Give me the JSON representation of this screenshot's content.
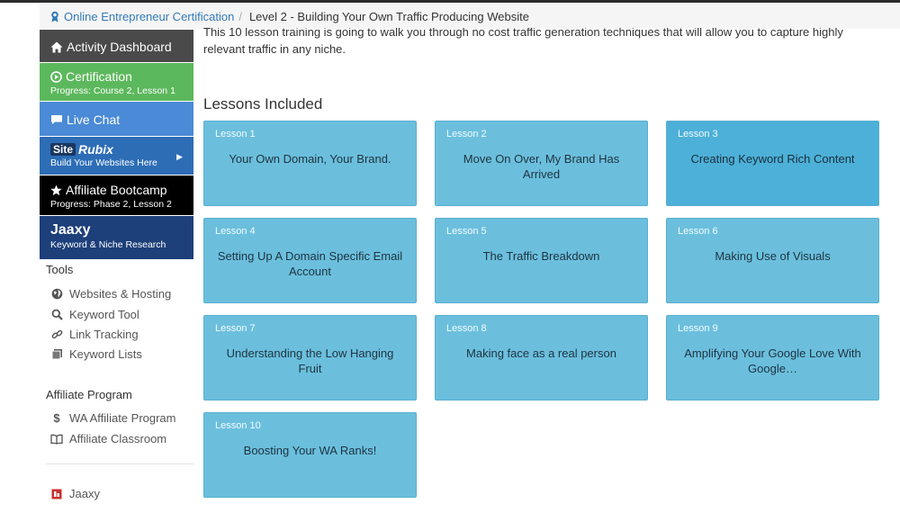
{
  "breadcrumb": {
    "link": "Online Entrepreneur Certification",
    "separator": "/",
    "current": "Level 2 - Building Your Own Traffic Producing Website"
  },
  "sidebar": {
    "dashboard": "Activity Dashboard",
    "certification": {
      "label": "Certification",
      "progress": "Progress: Course 2, Lesson 1"
    },
    "live_chat": "Live Chat",
    "siterubix": {
      "logo_site": "Site",
      "logo_rubix": "Rubix",
      "tagline": "Build Your Websites Here"
    },
    "bootcamp": {
      "label": "Affiliate Bootcamp",
      "progress": "Progress: Phase 2, Lesson 2"
    },
    "jaaxy": {
      "logo": "Jaaxy",
      "tagline": "Keyword & Niche Research"
    },
    "tools_heading": "Tools",
    "tools": [
      {
        "label": "Websites & Hosting",
        "icon": "globe-icon"
      },
      {
        "label": "Keyword Tool",
        "icon": "search-icon"
      },
      {
        "label": "Link Tracking",
        "icon": "link-icon"
      },
      {
        "label": "Keyword Lists",
        "icon": "list-icon"
      }
    ],
    "affiliate_heading": "Affiliate Program",
    "affiliate": [
      {
        "label": "WA Affiliate Program",
        "icon": "dollar-icon"
      },
      {
        "label": "Affiliate Classroom",
        "icon": "book-icon"
      }
    ],
    "jaaxy_link": "Jaaxy"
  },
  "main": {
    "intro": "This 10 lesson training is going to walk you through no cost traffic generation techniques that will allow you to capture highly relevant traffic in any niche.",
    "section_title": "Lessons Included",
    "lessons": [
      {
        "num": "Lesson 1",
        "title": "Your Own Domain, Your Brand."
      },
      {
        "num": "Lesson 2",
        "title": "Move On Over, My Brand Has Arrived"
      },
      {
        "num": "Lesson 3",
        "title": "Creating Keyword Rich Content"
      },
      {
        "num": "Lesson 4",
        "title": "Setting Up A Domain Specific Email Account"
      },
      {
        "num": "Lesson 5",
        "title": "The Traffic Breakdown"
      },
      {
        "num": "Lesson 6",
        "title": "Making Use of Visuals"
      },
      {
        "num": "Lesson 7",
        "title": "Understanding the Low Hanging Fruit"
      },
      {
        "num": "Lesson 8",
        "title": "Making face as a real person"
      },
      {
        "num": "Lesson 9",
        "title": "Amplifying Your Google Love With Google…"
      },
      {
        "num": "Lesson 10",
        "title": "Boosting Your WA Ranks!"
      }
    ]
  },
  "colors": {
    "lesson_tile": "#6bbfdd",
    "lesson_tile_active": "#4db0d8",
    "certification": "#5cb85c",
    "live_chat": "#4a8ad6",
    "bootcamp": "#000000",
    "jaaxy": "#1d3f7a"
  }
}
